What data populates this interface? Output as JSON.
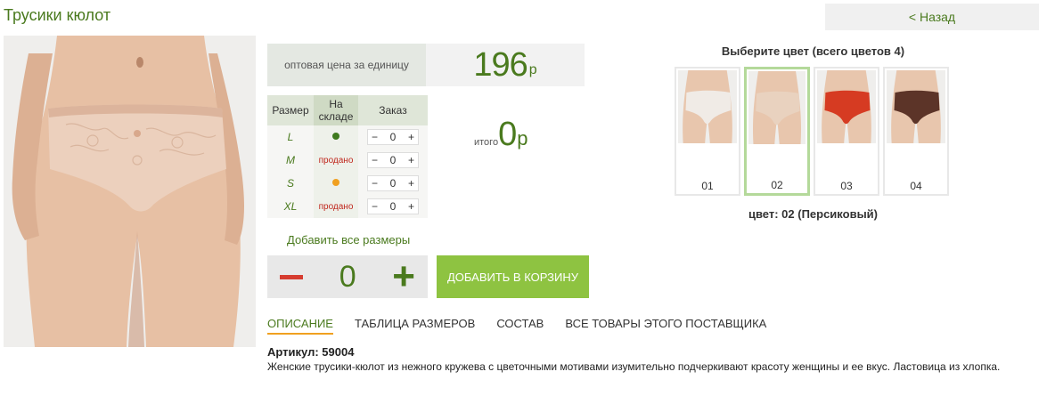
{
  "product": {
    "title": "Трусики кюлот",
    "back_label": "< Назад"
  },
  "price": {
    "label": "оптовая цена за единицу",
    "value": "196",
    "currency": "р"
  },
  "size_table": {
    "headers": [
      "Размер",
      "На складе",
      "Заказ"
    ],
    "rows": [
      {
        "size": "L",
        "stock": "in-stock",
        "stock_text": "",
        "qty": "0",
        "dot_color": "#3e7a1e"
      },
      {
        "size": "M",
        "stock": "sold",
        "stock_text": "продано",
        "qty": "0"
      },
      {
        "size": "S",
        "stock": "low-stock",
        "stock_text": "",
        "qty": "0",
        "dot_color": "#f0a020"
      },
      {
        "size": "XL",
        "stock": "sold",
        "stock_text": "продано",
        "qty": "0"
      }
    ],
    "minus_symbol": "−",
    "plus_symbol": "+"
  },
  "total": {
    "label": "итого",
    "value": "0",
    "currency": "р"
  },
  "add_all_label": "Добавить все размеры",
  "quantity": {
    "value": "0",
    "plus_symbol": "+"
  },
  "cart_button_label": "ДОБАВИТЬ В КОРЗИНУ",
  "tabs": [
    {
      "label": "ОПИСАНИЕ",
      "active": true
    },
    {
      "label": "ТАБЛИЦА РАЗМЕРОВ",
      "active": false
    },
    {
      "label": "СОСТАВ",
      "active": false
    },
    {
      "label": "ВСЕ ТОВАРЫ ЭТОГО ПОСТАВЩИКА",
      "active": false
    }
  ],
  "description": {
    "article": "Артикул: 59004",
    "text": "Женские трусики-кюлот из нежного кружева с цветочными мотивами изумительно подчеркивают красоту женщины и ее вкус. Ластовица из хлопка."
  },
  "colors": {
    "title": "Выберите цвет (всего цветов 4)",
    "items": [
      {
        "num": "01",
        "color": "#f0ebe6",
        "selected": false
      },
      {
        "num": "02",
        "color": "#e9d2bf",
        "selected": true
      },
      {
        "num": "03",
        "color": "#d63b22",
        "selected": false
      },
      {
        "num": "04",
        "color": "#5c3428",
        "selected": false
      }
    ],
    "current": "цвет: 02 (Персиковый)"
  },
  "accent_colors": {
    "green": "#4a7a1e",
    "button_green": "#8ec341",
    "minus_red": "#d63c30",
    "tab_underline": "#f0a020"
  }
}
